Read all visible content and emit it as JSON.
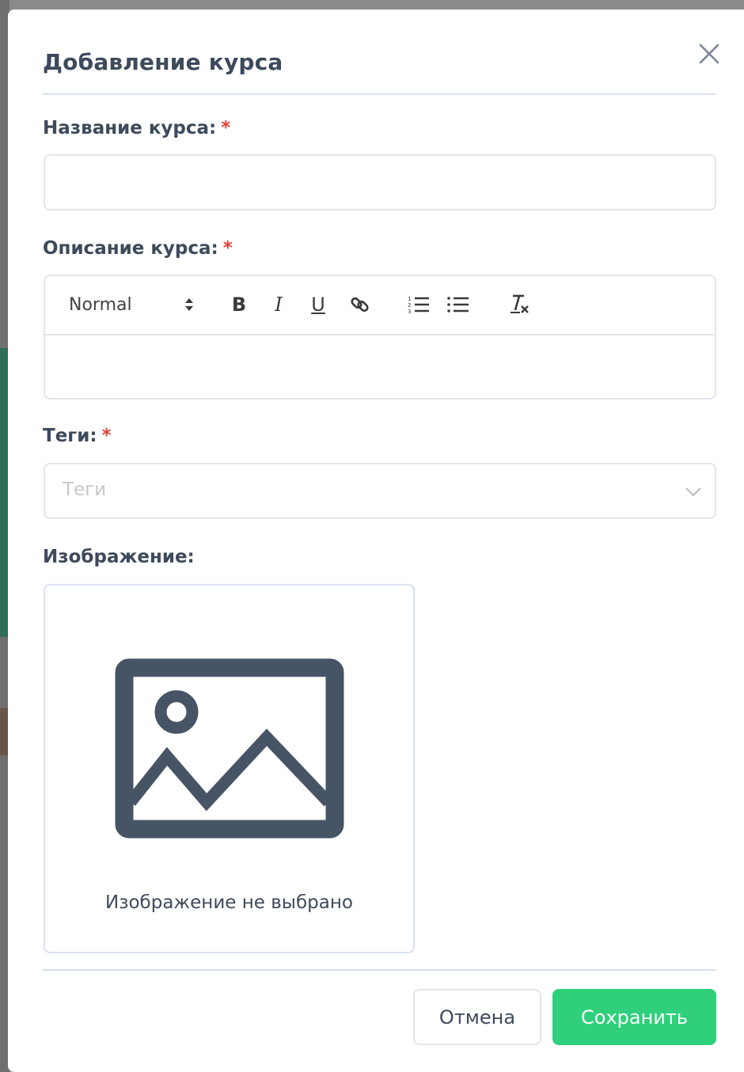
{
  "modal": {
    "title": "Добавление курса"
  },
  "form": {
    "name_label": "Название курса:",
    "name_value": "",
    "description_label": "Описание курса:",
    "tags_label": "Теги:",
    "tags_placeholder": "Теги",
    "image_label": "Изображение:",
    "image_empty_text": "Изображение не выбрано",
    "required_mark": "*",
    "required_color": "#e0423a"
  },
  "editor": {
    "format_value": "Normal",
    "tools": [
      "bold",
      "italic",
      "underline",
      "link",
      "ordered-list",
      "bullet-list",
      "clean-format"
    ],
    "tool_glyphs": {
      "bold": "B",
      "italic": "I",
      "underline": "U"
    }
  },
  "buttons": {
    "cancel": "Отмена",
    "save": "Сохранить",
    "save_color": "#2fcf7c"
  },
  "icons": [
    "close-icon",
    "bold-icon",
    "italic-icon",
    "underline-icon",
    "link-icon",
    "ordered-list-icon",
    "bullet-list-icon",
    "clear-format-icon",
    "chevron-down-icon",
    "image-placeholder-icon"
  ]
}
